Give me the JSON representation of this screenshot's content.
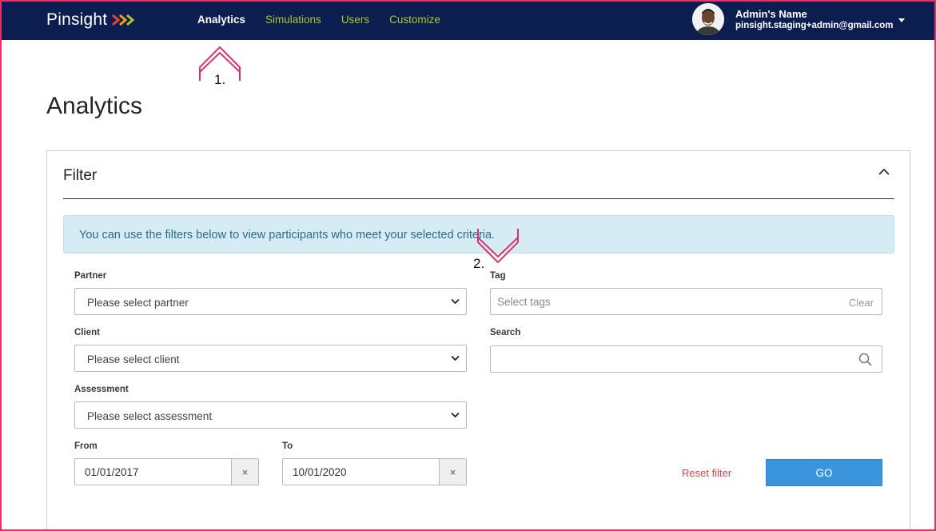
{
  "navbar": {
    "logo_text": "Pinsight",
    "links": [
      {
        "label": "Analytics",
        "active": true
      },
      {
        "label": "Simulations",
        "active": false
      },
      {
        "label": "Users",
        "active": false
      },
      {
        "label": "Customize",
        "active": false
      }
    ],
    "user": {
      "name": "Admin's Name",
      "email": "pinsight.staging+admin@gmail.com"
    },
    "colors": {
      "background": "#0c1d4f",
      "link": "#a8c82a",
      "active_link": "#ffffff"
    }
  },
  "annotations": {
    "first": "1.",
    "second": "2."
  },
  "page": {
    "title": "Analytics"
  },
  "filter": {
    "title": "Filter",
    "info_text": "You can use the filters below to view participants who meet your selected criteria.",
    "partner": {
      "label": "Partner",
      "value": "Please select partner"
    },
    "client": {
      "label": "Client",
      "value": "Please select client"
    },
    "assessment": {
      "label": "Assessment",
      "value": "Please select assessment"
    },
    "from": {
      "label": "From",
      "value": "01/01/2017",
      "clear": "×"
    },
    "to": {
      "label": "To",
      "value": "10/01/2020",
      "clear": "×"
    },
    "tag": {
      "label": "Tag",
      "placeholder": "Select tags",
      "clear": "Clear"
    },
    "search": {
      "label": "Search",
      "placeholder": ""
    },
    "reset_label": "Reset filter",
    "go_label": "GO"
  },
  "icons": {
    "collapse": "chevron-up-icon",
    "select_caret": "chevron-down-icon",
    "search": "search-icon",
    "user_menu": "caret-down-icon"
  },
  "accent_color": "#e4336b",
  "button_color": "#3b95dc"
}
